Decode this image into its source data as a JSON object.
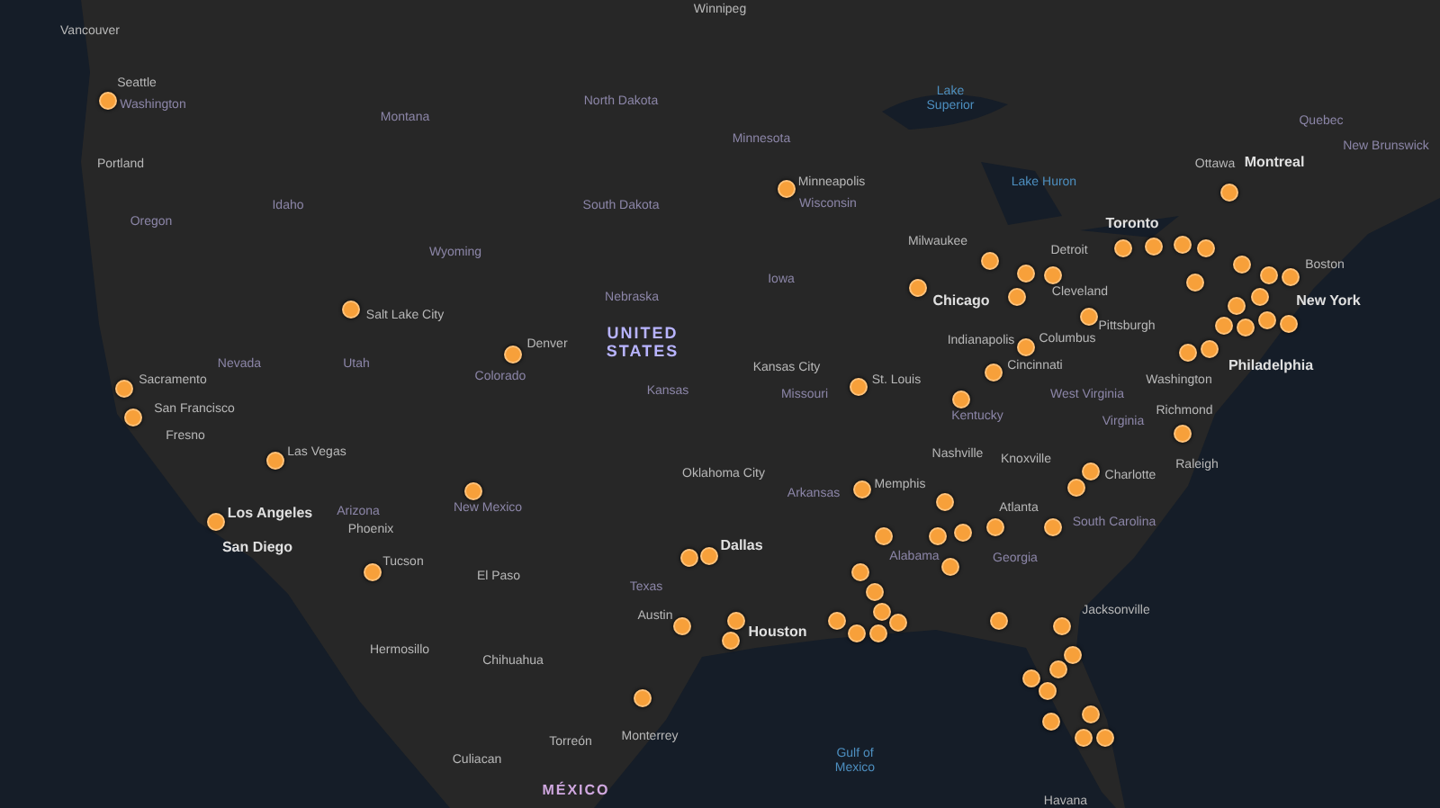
{
  "map": {
    "labels": [
      {
        "text": "Vancouver",
        "kind": "city"
      },
      {
        "text": "Winnipeg",
        "kind": "city"
      },
      {
        "text": "Seattle",
        "kind": "city"
      },
      {
        "text": "Washington",
        "kind": "state"
      },
      {
        "text": "Portland",
        "kind": "city"
      },
      {
        "text": "Montana",
        "kind": "state"
      },
      {
        "text": "North Dakota",
        "kind": "state"
      },
      {
        "text": "Minnesota",
        "kind": "state"
      },
      {
        "text": "Lake Superior",
        "kind": "water"
      },
      {
        "text": "Ottawa",
        "kind": "city"
      },
      {
        "text": "Montreal",
        "kind": "bigcity"
      },
      {
        "text": "Quebec",
        "kind": "state"
      },
      {
        "text": "New Brunswick",
        "kind": "state"
      },
      {
        "text": "Oregon",
        "kind": "state"
      },
      {
        "text": "Idaho",
        "kind": "state"
      },
      {
        "text": "Wyoming",
        "kind": "state"
      },
      {
        "text": "South Dakota",
        "kind": "state"
      },
      {
        "text": "Minneapolis",
        "kind": "city"
      },
      {
        "text": "Wisconsin",
        "kind": "state"
      },
      {
        "text": "Lake Huron",
        "kind": "water"
      },
      {
        "text": "Milwaukee",
        "kind": "city"
      },
      {
        "text": "Toronto",
        "kind": "bigcity"
      },
      {
        "text": "Detroit",
        "kind": "city"
      },
      {
        "text": "Boston",
        "kind": "city"
      },
      {
        "text": "Nebraska",
        "kind": "state"
      },
      {
        "text": "Iowa",
        "kind": "state"
      },
      {
        "text": "Chicago",
        "kind": "bigcity"
      },
      {
        "text": "Cleveland",
        "kind": "city"
      },
      {
        "text": "New York",
        "kind": "bigcity"
      },
      {
        "text": "Pittsburgh",
        "kind": "city"
      },
      {
        "text": "Philadelphia",
        "kind": "bigcity"
      },
      {
        "text": "Salt Lake City",
        "kind": "city"
      },
      {
        "text": "Nevada",
        "kind": "state"
      },
      {
        "text": "Utah",
        "kind": "state"
      },
      {
        "text": "Colorado",
        "kind": "state"
      },
      {
        "text": "Denver",
        "kind": "city"
      },
      {
        "text": "UNITED STATES",
        "kind": "country"
      },
      {
        "text": "Sacramento",
        "kind": "city"
      },
      {
        "text": "San Francisco",
        "kind": "city"
      },
      {
        "text": "Kansas",
        "kind": "state"
      },
      {
        "text": "Kansas City",
        "kind": "city"
      },
      {
        "text": "St. Louis",
        "kind": "city"
      },
      {
        "text": "Indianapolis",
        "kind": "city"
      },
      {
        "text": "Columbus",
        "kind": "city"
      },
      {
        "text": "Cincinnati",
        "kind": "city"
      },
      {
        "text": "Washington",
        "kind": "city"
      },
      {
        "text": "Missouri",
        "kind": "state"
      },
      {
        "text": "Kentucky",
        "kind": "state"
      },
      {
        "text": "West Virginia",
        "kind": "state"
      },
      {
        "text": "Virginia",
        "kind": "state"
      },
      {
        "text": "Richmond",
        "kind": "city"
      },
      {
        "text": "Fresno",
        "kind": "city"
      },
      {
        "text": "Las Vegas",
        "kind": "city"
      },
      {
        "text": "Nashville",
        "kind": "city"
      },
      {
        "text": "Knoxville",
        "kind": "city"
      },
      {
        "text": "Oklahoma City",
        "kind": "city"
      },
      {
        "text": "Arkansas",
        "kind": "state"
      },
      {
        "text": "Memphis",
        "kind": "city"
      },
      {
        "text": "Charlotte",
        "kind": "city"
      },
      {
        "text": "Raleigh",
        "kind": "city"
      },
      {
        "text": "Los Angeles",
        "kind": "bigcity"
      },
      {
        "text": "Arizona",
        "kind": "state"
      },
      {
        "text": "Phoenix",
        "kind": "city"
      },
      {
        "text": "New Mexico",
        "kind": "state"
      },
      {
        "text": "San Diego",
        "kind": "bigcity"
      },
      {
        "text": "Tucson",
        "kind": "city"
      },
      {
        "text": "El Paso",
        "kind": "city"
      },
      {
        "text": "Dallas",
        "kind": "bigcity"
      },
      {
        "text": "Texas",
        "kind": "state"
      },
      {
        "text": "Atlanta",
        "kind": "city"
      },
      {
        "text": "South Carolina",
        "kind": "state"
      },
      {
        "text": "Alabama",
        "kind": "state"
      },
      {
        "text": "Georgia",
        "kind": "state"
      },
      {
        "text": "Jacksonville",
        "kind": "city"
      },
      {
        "text": "Austin",
        "kind": "city"
      },
      {
        "text": "Houston",
        "kind": "bigcity"
      },
      {
        "text": "Hermosillo",
        "kind": "city"
      },
      {
        "text": "Chihuahua",
        "kind": "city"
      },
      {
        "text": "Torreón",
        "kind": "city"
      },
      {
        "text": "Monterrey",
        "kind": "city"
      },
      {
        "text": "Gulf of Mexico",
        "kind": "water"
      },
      {
        "text": "Culiacan",
        "kind": "city"
      },
      {
        "text": "MÉXICO",
        "kind": "country2"
      },
      {
        "text": "Havana",
        "kind": "city"
      }
    ]
  }
}
